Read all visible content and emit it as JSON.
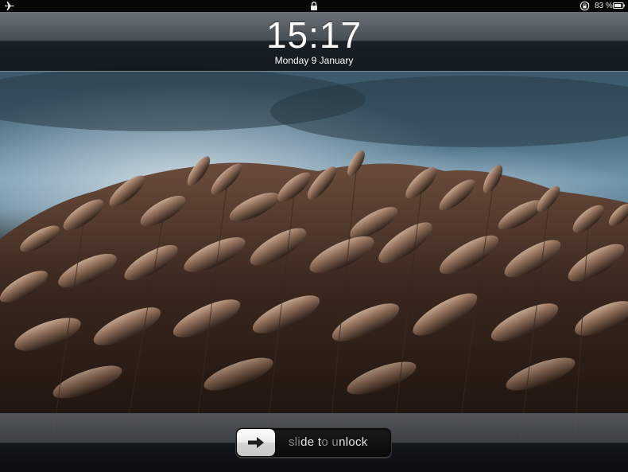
{
  "status_bar": {
    "left_icon": "airplane-icon",
    "center_icon": "lock-icon",
    "right_icons": [
      "rotation-lock-icon",
      "battery-icon"
    ],
    "battery_percent": "83 %"
  },
  "lock_screen": {
    "time": "15:17",
    "date": "Monday 9 January"
  },
  "unlock": {
    "knob_icon": "arrow-right-icon",
    "label_part1": "sli",
    "label_part2": "de t",
    "label_part3": "o u",
    "label_part4": "nlock"
  },
  "colors": {
    "clock_text": "#ffffff",
    "slider_text": "#8a8a8a",
    "slider_highlight": "#e6e6e6"
  }
}
